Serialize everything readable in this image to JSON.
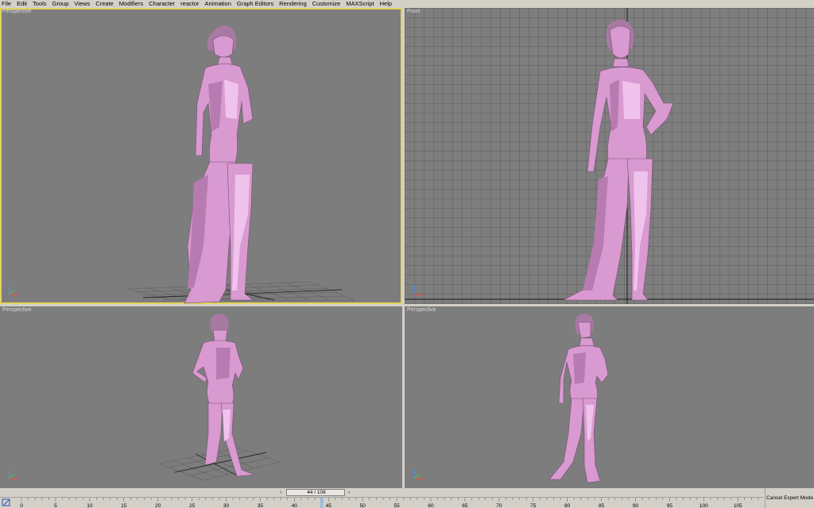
{
  "menu": [
    "File",
    "Edit",
    "Tools",
    "Group",
    "Views",
    "Create",
    "Modifiers",
    "Character",
    "reactor",
    "Animation",
    "Graph Editors",
    "Rendering",
    "Customize",
    "MAXScript",
    "Help"
  ],
  "viewports": {
    "top_left": {
      "label": "Perspective",
      "active": true
    },
    "top_right": {
      "label": "Front",
      "active": false
    },
    "bottom_left": {
      "label": "Perspective",
      "active": false
    },
    "bottom_right": {
      "label": "Perspective",
      "active": false
    }
  },
  "timeline": {
    "frame_display": "44 / 108",
    "current_frame": 44,
    "total_frames": 108,
    "tick_labels": [
      "0",
      "5",
      "10",
      "15",
      "20",
      "25",
      "30",
      "35",
      "40",
      "45",
      "50",
      "55",
      "60",
      "65",
      "70",
      "75",
      "80",
      "85",
      "90",
      "95",
      "100",
      "105"
    ]
  },
  "status": {
    "expert_mode_button": "Cancel Expert Mode"
  },
  "colors": {
    "viewport_bg": "#7d7d7d",
    "active_border": "#e2d35b",
    "figure": "#d89ad1",
    "ui_bg": "#d4d0c8"
  },
  "icons": {
    "axis": "axis-tripod-icon",
    "key": "key-mode-icon"
  }
}
